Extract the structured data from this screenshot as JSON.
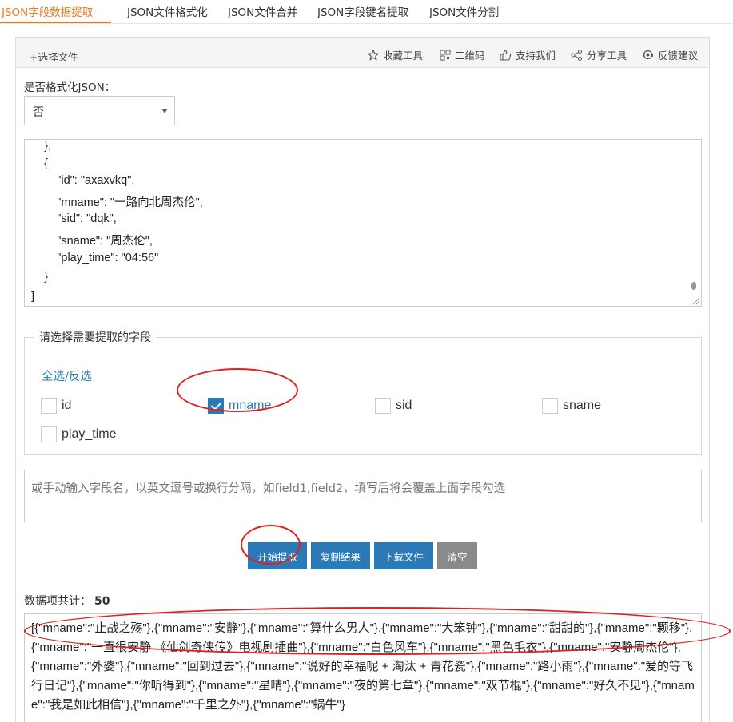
{
  "tabs": [
    {
      "label": "JSON字段数据提取",
      "active": true
    },
    {
      "label": "JSON文件格式化",
      "active": false
    },
    {
      "label": "JSON文件合并",
      "active": false
    },
    {
      "label": "JSON字段键名提取",
      "active": false
    },
    {
      "label": "JSON文件分割",
      "active": false
    }
  ],
  "toolbar": {
    "choose_file": "+选择文件",
    "favorite": "收藏工具",
    "qrcode": "二维码",
    "support": "支持我们",
    "share": "分享工具",
    "feedback": "反馈建议"
  },
  "format": {
    "label": "是否格式化JSON：",
    "value": "否"
  },
  "code_lines": [
    "    },",
    "    {",
    "        \"id\": \"axaxvkq\",",
    "        \"mname\": \"一路向北周杰伦\",",
    "        \"sid\": \"dqk\",",
    "        \"sname\": \"周杰伦\",",
    "        \"play_time\": \"04:56\"",
    "    }",
    "]"
  ],
  "fields": {
    "legend": "请选择需要提取的字段",
    "select_all": "全选/反选",
    "items": [
      {
        "label": "id",
        "checked": false
      },
      {
        "label": "mname",
        "checked": true
      },
      {
        "label": "sid",
        "checked": false
      },
      {
        "label": "sname",
        "checked": false
      },
      {
        "label": "play_time",
        "checked": false
      }
    ]
  },
  "manual": {
    "placeholder": "或手动输入字段名，以英文逗号或换行分隔，如field1,field2，填写后将会覆盖上面字段勾选"
  },
  "buttons": {
    "start": "开始提取",
    "copy": "复制结果",
    "download": "下载文件",
    "clear": "清空"
  },
  "count": {
    "label": "数据项共计：",
    "value": "50"
  },
  "result_text": "[{\"mname\":\"止战之殇\"},{\"mname\":\"安静\"},{\"mname\":\"算什么男人\"},{\"mname\":\"大笨钟\"},{\"mname\":\"甜甜的\"},{\"mname\":\"颗移\"},{\"mname\":\"一直很安静 《仙剑奇侠传》电视剧插曲\"},{\"mname\":\"白色风车\"},{\"mname\":\"黑色毛衣\"},{\"mname\":\"安静周杰伦\"},{\"mname\":\"外婆\"},{\"mname\":\"回到过去\"},{\"mname\":\"说好的幸福呢 + 淘汰 + 青花瓷\"},{\"mname\":\"路小雨\"},{\"mname\":\"爱的等飞行日记\"},{\"mname\":\"你听得到\"},{\"mname\":\"星晴\"},{\"mname\":\"夜的第七章\"},{\"mname\":\"双节棍\"},{\"mname\":\"好久不见\"},{\"mname\":\"我是如此相信\"},{\"mname\":\"千里之外\"},{\"mname\":\"蜗牛\"}"
}
